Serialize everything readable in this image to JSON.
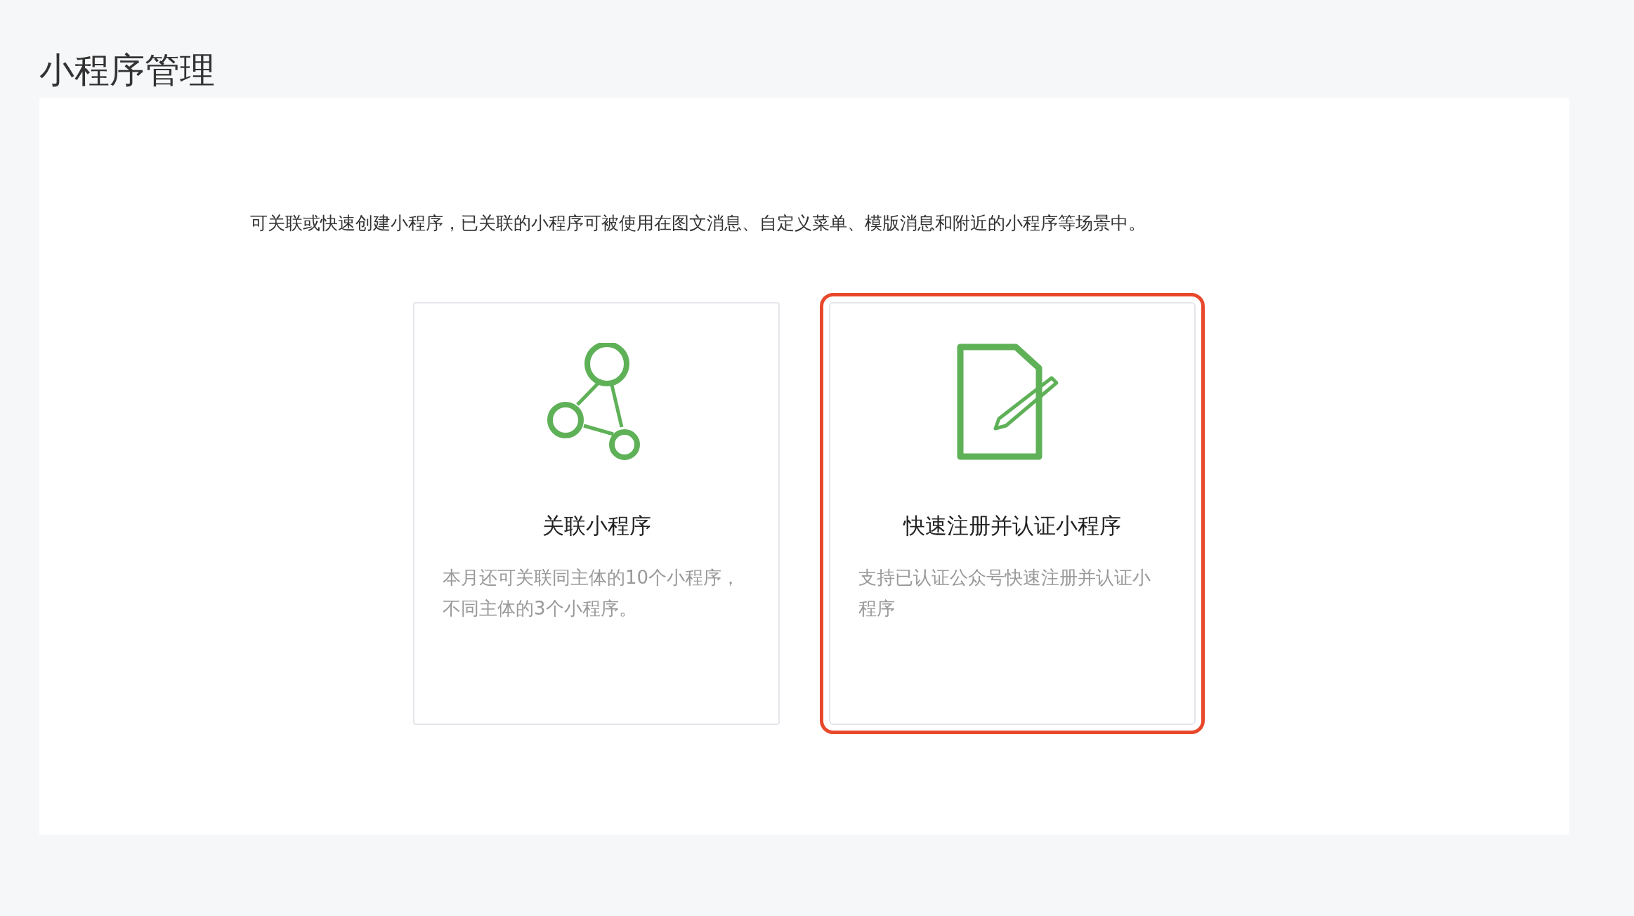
{
  "page_title": "小程序管理",
  "intro": "可关联或快速创建小程序，已关联的小程序可被使用在图文消息、自定义菜单、模版消息和附近的小程序等场景中。",
  "cards": [
    {
      "kind": "link",
      "title": "关联小程序",
      "description": "本月还可关联同主体的10个小程序，不同主体的3个小程序。",
      "highlighted": false
    },
    {
      "kind": "register",
      "title": "快速注册并认证小程序",
      "description": "支持已认证公众号快速注册并认证小程序",
      "highlighted": true
    }
  ]
}
